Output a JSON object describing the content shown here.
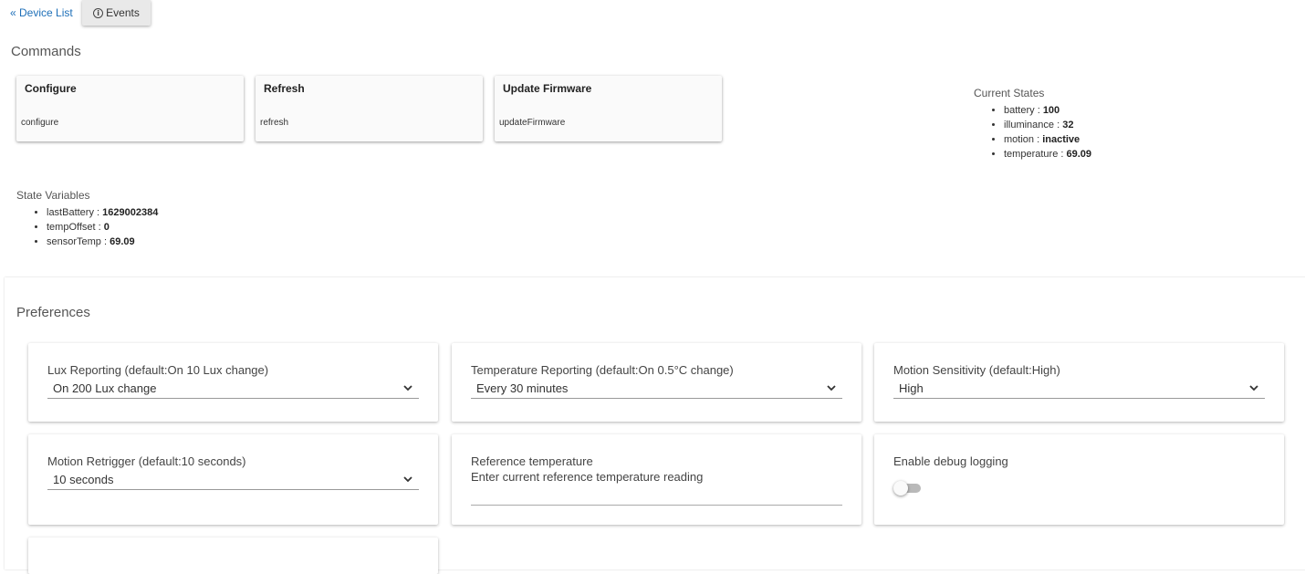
{
  "nav": {
    "back_label": "« Device List",
    "events_label": "Events"
  },
  "commands": {
    "title": "Commands",
    "items": [
      {
        "name": "Configure",
        "method": "configure"
      },
      {
        "name": "Refresh",
        "method": "refresh"
      },
      {
        "name": "Update Firmware",
        "method": "updateFirmware"
      }
    ]
  },
  "current_states": {
    "title": "Current States",
    "items": [
      {
        "key": "battery",
        "value": "100"
      },
      {
        "key": "illuminance",
        "value": "32"
      },
      {
        "key": "motion",
        "value": "inactive"
      },
      {
        "key": "temperature",
        "value": "69.09"
      }
    ]
  },
  "state_variables": {
    "title": "State Variables",
    "items": [
      {
        "key": "lastBattery",
        "value": "1629002384"
      },
      {
        "key": "tempOffset",
        "value": "0"
      },
      {
        "key": "sensorTemp",
        "value": "69.09"
      }
    ]
  },
  "preferences": {
    "title": "Preferences",
    "lux": {
      "label": "Lux Reporting (default:On 10 Lux change)",
      "value": "On 200 Lux change"
    },
    "temp_reporting": {
      "label": "Temperature Reporting (default:On 0.5°C change)",
      "value": "Every 30 minutes"
    },
    "motion_sensitivity": {
      "label": "Motion Sensitivity (default:High)",
      "value": "High"
    },
    "motion_retrigger": {
      "label": "Motion Retrigger (default:10 seconds)",
      "value": "10 seconds"
    },
    "reference_temp": {
      "label": "Reference temperature",
      "placeholder": "Enter current reference temperature reading",
      "value": ""
    },
    "debug_logging": {
      "label": "Enable debug logging",
      "enabled": false
    }
  },
  "colors": {
    "link": "#1e6fb8",
    "toggle_off": "#b9b9b9"
  },
  "icons": {
    "events": "info-icon",
    "select": "chevron-down-icon"
  }
}
